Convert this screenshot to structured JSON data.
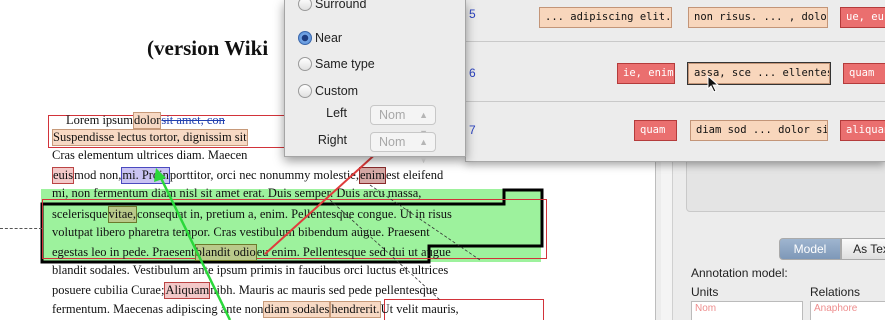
{
  "document": {
    "title": "(version Wiki",
    "lines": [
      [
        "Lorem ipsum ",
        "dolor",
        " sit amet, con"
      ],
      [
        "Suspendisse lectus tortor, dignissim sit",
        "",
        ""
      ],
      [
        "Cras elementum ultrices diam. Maecen",
        "",
        ""
      ],
      [
        "euismod non, ",
        "mi. Proin",
        " porttitor, orci nec nonummy molestie, ",
        "enim",
        " est eleifend"
      ],
      [
        "mi, non fermentum diam nisl sit amet erat. Duis semper. Duis arcu massa,",
        "",
        ""
      ],
      [
        "scelerisque ",
        "vitae,",
        " consequat in, pretium a, enim. Pellentesque congue. Ut in risus"
      ],
      [
        "volutpat libero pharetra tempor. Cras vestibulum bibendum augue. Praesent"
      ],
      [
        "egestas leo in pede. Praesent ",
        "blandit odio",
        " eu enim. Pellentesque sed dui ut augue"
      ],
      [
        "blandit sodales. Vestibulum ante ipsum primis in faucibus orci luctus et ultrices"
      ],
      [
        "posuere cubilia Curae; ",
        "Aliquam",
        " nibh. Mauris ac mauris sed pede pellentesque"
      ],
      [
        "fermentum. Maecenas adipiscing ante non ",
        "diam sodales",
        " ",
        "hendrerit.",
        " Ut velit mauris,"
      ]
    ]
  },
  "popup": {
    "partial_option": "Surround",
    "options": [
      {
        "label": "Near",
        "selected": true
      },
      {
        "label": "Same type",
        "selected": false
      },
      {
        "label": "Custom",
        "selected": false
      }
    ],
    "left_label": "Left",
    "right_label": "Right",
    "left_value": "Nom",
    "right_value": "Nom"
  },
  "results": {
    "rows": [
      {
        "num": "5",
        "chips": [
          "... adipiscing elit. Sed",
          "non risus. ... , dolor. C",
          "ue, eu"
        ]
      },
      {
        "num": "6",
        "chips": [
          "ie, enim",
          "assa, sce ... ellentesqu",
          "quam"
        ]
      },
      {
        "num": "7",
        "chips": [
          "quam",
          "diam sod ... dolor sit",
          "aliquan"
        ]
      }
    ]
  },
  "right_panel": {
    "tabs": [
      "Model",
      "As Tex"
    ],
    "annotation_model_label": "Annotation model:",
    "units_label": "Units",
    "relations_label": "Relations",
    "units_first": "Nom",
    "relations_first": "Anaphore"
  },
  "colors": {
    "accent_blue": "#2b43c0",
    "chip_orange": "#f8d6bc",
    "chip_red": "#ea6f6f",
    "green_highlight": "#9df29d",
    "relation_red": "#d2333a"
  }
}
